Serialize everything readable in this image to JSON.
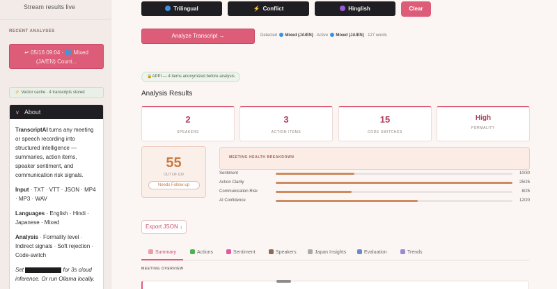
{
  "sidebar": {
    "stream_label": "Stream results live",
    "recent_heading": "RECENT ANALYSES",
    "recent_item_line1": "↵ 05/16 09:04 · 🌐 Mixed",
    "recent_item_line2": "(JA/EN) Count...",
    "cache_note": "Vector cache · 4 transcripts stored",
    "about_title": "About",
    "about_intro_brand": "TranscriptAI",
    "about_intro_rest": " turns any meeting or speech recording into structured intelligence — summaries, action items, speaker sentiment, and communication risk signals.",
    "input_label": "Input",
    "input_value": " · TXT · VTT · JSON · MP4 · MP3 · WAV",
    "languages_label": "Languages",
    "languages_value": " · English · Hindi · Japanese · Mixed",
    "analysis_label": "Analysis",
    "analysis_value": " · Formality level · Indirect signals · Soft rejection · Code-switch",
    "set_prefix": "Set",
    "set_suffix": " for 3s cloud inference. Or run Ollama locally."
  },
  "chips": [
    {
      "label": "Trilingual",
      "icon": "globe-icon",
      "color": "#3d8ee0"
    },
    {
      "label": "Conflict",
      "icon": "bolt-icon",
      "color": "#e58b3a"
    },
    {
      "label": "Hinglish",
      "icon": "moon-icon",
      "color": "#9a5ad6"
    }
  ],
  "clear_label": "Clear",
  "analyze_label": "Analyze Transcript →",
  "detection": {
    "detected_label": "Detected",
    "detected_value": "Mixed (JA/EN)",
    "active_label": "· Active",
    "active_value": "Mixed (JA/EN)",
    "word_count": "· 127 words"
  },
  "appi_note": "APPI — 4 items anonymized before analysis",
  "results_heading": "Analysis Results",
  "metrics": [
    {
      "value": "2",
      "label": "SPEAKERS"
    },
    {
      "value": "3",
      "label": "ACTION ITEMS"
    },
    {
      "value": "15",
      "label": "CODE SWITCHES"
    },
    {
      "value": "High",
      "label": "FORMALITY"
    }
  ],
  "health": {
    "score": "55",
    "out_of": "OUT OF 100",
    "status": "Needs Follow-up",
    "banner": "MEETING HEALTH BREAKDOWN",
    "rows": [
      {
        "label": "Sentiment",
        "value": "10/30",
        "fraction": 0.333
      },
      {
        "label": "Action Clarity",
        "value": "25/25",
        "fraction": 1.0
      },
      {
        "label": "Communication Risk",
        "value": "8/25",
        "fraction": 0.32
      },
      {
        "label": "AI Confidence",
        "value": "12/20",
        "fraction": 0.6
      }
    ]
  },
  "export_label": "Export JSON ↓",
  "tabs": [
    {
      "label": "Summary",
      "icon": "summary-icon",
      "color": "#e8a0a8"
    },
    {
      "label": "Actions",
      "icon": "check-icon",
      "color": "#4fb24f"
    },
    {
      "label": "Sentiment",
      "icon": "heart-icon",
      "color": "#e05aa0"
    },
    {
      "label": "Speakers",
      "icon": "microphone-icon",
      "color": "#8a6a5a"
    },
    {
      "label": "Japan Insights",
      "icon": "japan-icon",
      "color": "#aaaaaa"
    },
    {
      "label": "Evaluation",
      "icon": "chart-icon",
      "color": "#6a8ad0"
    },
    {
      "label": "Trends",
      "icon": "trend-icon",
      "color": "#9a8ad0"
    }
  ],
  "overview_heading": "MEETING OVERVIEW"
}
